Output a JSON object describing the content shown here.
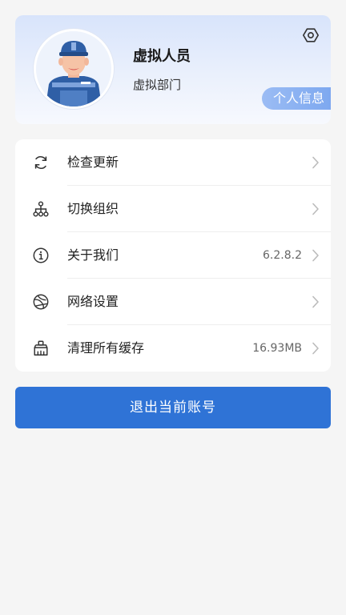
{
  "profile": {
    "name": "虚拟人员",
    "department": "虚拟部门",
    "info_button": "个人信息",
    "settings_icon": "settings-icon",
    "avatar": "worker-avatar"
  },
  "menu": {
    "items": [
      {
        "icon": "refresh-icon",
        "label": "检查更新",
        "value": ""
      },
      {
        "icon": "org-tree-icon",
        "label": "切换组织",
        "value": ""
      },
      {
        "icon": "info-icon",
        "label": "关于我们",
        "value": "6.2.8.2"
      },
      {
        "icon": "network-icon",
        "label": "网络设置",
        "value": ""
      },
      {
        "icon": "broom-icon",
        "label": "清理所有缓存",
        "value": "16.93MB"
      }
    ]
  },
  "logout": {
    "label": "退出当前账号"
  },
  "colors": {
    "accent": "#2f73d6",
    "background": "#f5f5f5",
    "card": "#ffffff"
  }
}
